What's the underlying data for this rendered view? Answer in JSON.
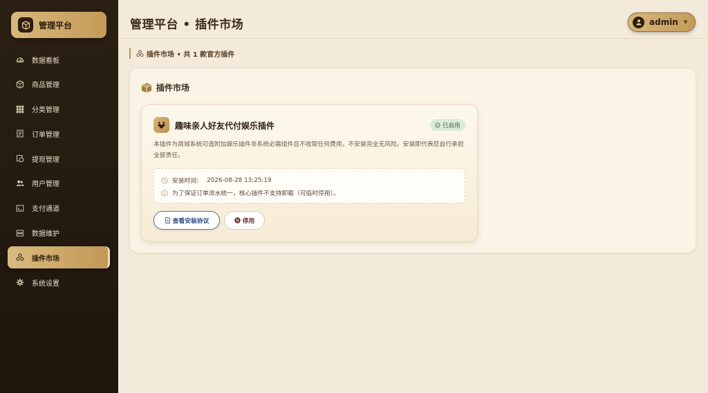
{
  "sidebar": {
    "brand": "管理平台",
    "items": [
      {
        "label": "数据看板",
        "icon": "dashboard-icon"
      },
      {
        "label": "商品管理",
        "icon": "box-icon"
      },
      {
        "label": "分类管理",
        "icon": "grid-icon"
      },
      {
        "label": "订单管理",
        "icon": "receipt-icon"
      },
      {
        "label": "提现管理",
        "icon": "withdraw-icon"
      },
      {
        "label": "用户管理",
        "icon": "users-icon"
      },
      {
        "label": "支付通道",
        "icon": "payment-icon"
      },
      {
        "label": "数据维护",
        "icon": "database-icon"
      },
      {
        "label": "插件市场",
        "icon": "plugin-icon",
        "active": true
      },
      {
        "label": "系统设置",
        "icon": "gear-icon"
      }
    ]
  },
  "header": {
    "title": "管理平台 • 插件市场",
    "user": "admin"
  },
  "breadcrumb": "插件市场 • 共 1 款官方插件",
  "panel": {
    "title": "插件市场"
  },
  "plugin": {
    "name": "趣味亲人好友代付娱乐插件",
    "status": "已启用",
    "description": "本插件为商城系统可选附加娱乐插件非系统必需组件且不收取任何费用，不安装完全无风险。安装即代表您自行承担全部责任。",
    "install_label": "安装时间:",
    "install_time": "2026-08-28 13:25:19",
    "notice": "为了保证订单流水统一，核心插件不支持卸载（可临时停用）。",
    "agreement_button": "查看安装协议",
    "disable_button": "停用"
  },
  "colors": {
    "sidebar_bg": "#2b2013",
    "gold_accent": "#c49a58",
    "page_bg": "#f3eadb",
    "status_green": "#3d6b3f",
    "link_blue": "#2f4d86"
  }
}
